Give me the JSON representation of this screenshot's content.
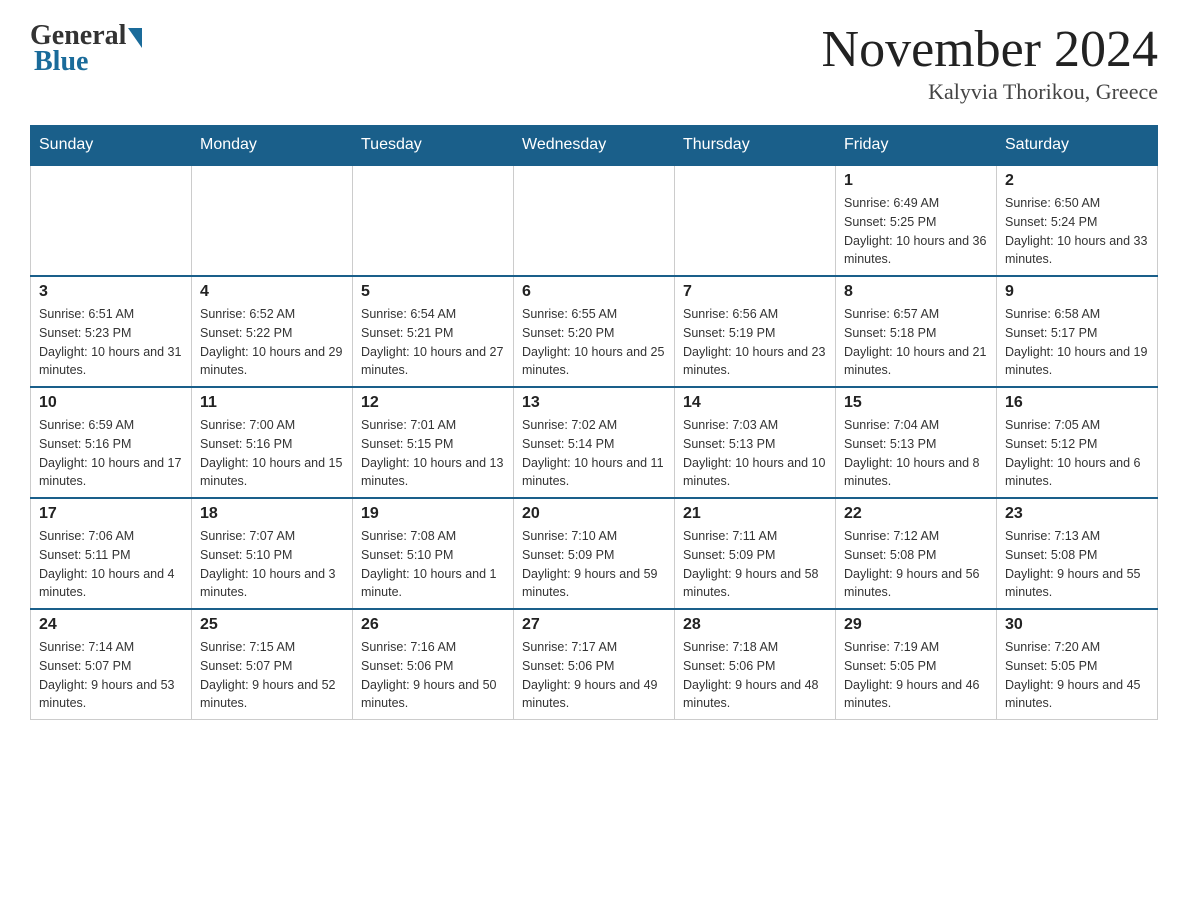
{
  "header": {
    "logo_general": "General",
    "logo_blue": "Blue",
    "month_title": "November 2024",
    "location": "Kalyvia Thorikou, Greece"
  },
  "days_of_week": [
    "Sunday",
    "Monday",
    "Tuesday",
    "Wednesday",
    "Thursday",
    "Friday",
    "Saturday"
  ],
  "weeks": [
    [
      {
        "day": "",
        "info": ""
      },
      {
        "day": "",
        "info": ""
      },
      {
        "day": "",
        "info": ""
      },
      {
        "day": "",
        "info": ""
      },
      {
        "day": "",
        "info": ""
      },
      {
        "day": "1",
        "info": "Sunrise: 6:49 AM\nSunset: 5:25 PM\nDaylight: 10 hours and 36 minutes."
      },
      {
        "day": "2",
        "info": "Sunrise: 6:50 AM\nSunset: 5:24 PM\nDaylight: 10 hours and 33 minutes."
      }
    ],
    [
      {
        "day": "3",
        "info": "Sunrise: 6:51 AM\nSunset: 5:23 PM\nDaylight: 10 hours and 31 minutes."
      },
      {
        "day": "4",
        "info": "Sunrise: 6:52 AM\nSunset: 5:22 PM\nDaylight: 10 hours and 29 minutes."
      },
      {
        "day": "5",
        "info": "Sunrise: 6:54 AM\nSunset: 5:21 PM\nDaylight: 10 hours and 27 minutes."
      },
      {
        "day": "6",
        "info": "Sunrise: 6:55 AM\nSunset: 5:20 PM\nDaylight: 10 hours and 25 minutes."
      },
      {
        "day": "7",
        "info": "Sunrise: 6:56 AM\nSunset: 5:19 PM\nDaylight: 10 hours and 23 minutes."
      },
      {
        "day": "8",
        "info": "Sunrise: 6:57 AM\nSunset: 5:18 PM\nDaylight: 10 hours and 21 minutes."
      },
      {
        "day": "9",
        "info": "Sunrise: 6:58 AM\nSunset: 5:17 PM\nDaylight: 10 hours and 19 minutes."
      }
    ],
    [
      {
        "day": "10",
        "info": "Sunrise: 6:59 AM\nSunset: 5:16 PM\nDaylight: 10 hours and 17 minutes."
      },
      {
        "day": "11",
        "info": "Sunrise: 7:00 AM\nSunset: 5:16 PM\nDaylight: 10 hours and 15 minutes."
      },
      {
        "day": "12",
        "info": "Sunrise: 7:01 AM\nSunset: 5:15 PM\nDaylight: 10 hours and 13 minutes."
      },
      {
        "day": "13",
        "info": "Sunrise: 7:02 AM\nSunset: 5:14 PM\nDaylight: 10 hours and 11 minutes."
      },
      {
        "day": "14",
        "info": "Sunrise: 7:03 AM\nSunset: 5:13 PM\nDaylight: 10 hours and 10 minutes."
      },
      {
        "day": "15",
        "info": "Sunrise: 7:04 AM\nSunset: 5:13 PM\nDaylight: 10 hours and 8 minutes."
      },
      {
        "day": "16",
        "info": "Sunrise: 7:05 AM\nSunset: 5:12 PM\nDaylight: 10 hours and 6 minutes."
      }
    ],
    [
      {
        "day": "17",
        "info": "Sunrise: 7:06 AM\nSunset: 5:11 PM\nDaylight: 10 hours and 4 minutes."
      },
      {
        "day": "18",
        "info": "Sunrise: 7:07 AM\nSunset: 5:10 PM\nDaylight: 10 hours and 3 minutes."
      },
      {
        "day": "19",
        "info": "Sunrise: 7:08 AM\nSunset: 5:10 PM\nDaylight: 10 hours and 1 minute."
      },
      {
        "day": "20",
        "info": "Sunrise: 7:10 AM\nSunset: 5:09 PM\nDaylight: 9 hours and 59 minutes."
      },
      {
        "day": "21",
        "info": "Sunrise: 7:11 AM\nSunset: 5:09 PM\nDaylight: 9 hours and 58 minutes."
      },
      {
        "day": "22",
        "info": "Sunrise: 7:12 AM\nSunset: 5:08 PM\nDaylight: 9 hours and 56 minutes."
      },
      {
        "day": "23",
        "info": "Sunrise: 7:13 AM\nSunset: 5:08 PM\nDaylight: 9 hours and 55 minutes."
      }
    ],
    [
      {
        "day": "24",
        "info": "Sunrise: 7:14 AM\nSunset: 5:07 PM\nDaylight: 9 hours and 53 minutes."
      },
      {
        "day": "25",
        "info": "Sunrise: 7:15 AM\nSunset: 5:07 PM\nDaylight: 9 hours and 52 minutes."
      },
      {
        "day": "26",
        "info": "Sunrise: 7:16 AM\nSunset: 5:06 PM\nDaylight: 9 hours and 50 minutes."
      },
      {
        "day": "27",
        "info": "Sunrise: 7:17 AM\nSunset: 5:06 PM\nDaylight: 9 hours and 49 minutes."
      },
      {
        "day": "28",
        "info": "Sunrise: 7:18 AM\nSunset: 5:06 PM\nDaylight: 9 hours and 48 minutes."
      },
      {
        "day": "29",
        "info": "Sunrise: 7:19 AM\nSunset: 5:05 PM\nDaylight: 9 hours and 46 minutes."
      },
      {
        "day": "30",
        "info": "Sunrise: 7:20 AM\nSunset: 5:05 PM\nDaylight: 9 hours and 45 minutes."
      }
    ]
  ]
}
